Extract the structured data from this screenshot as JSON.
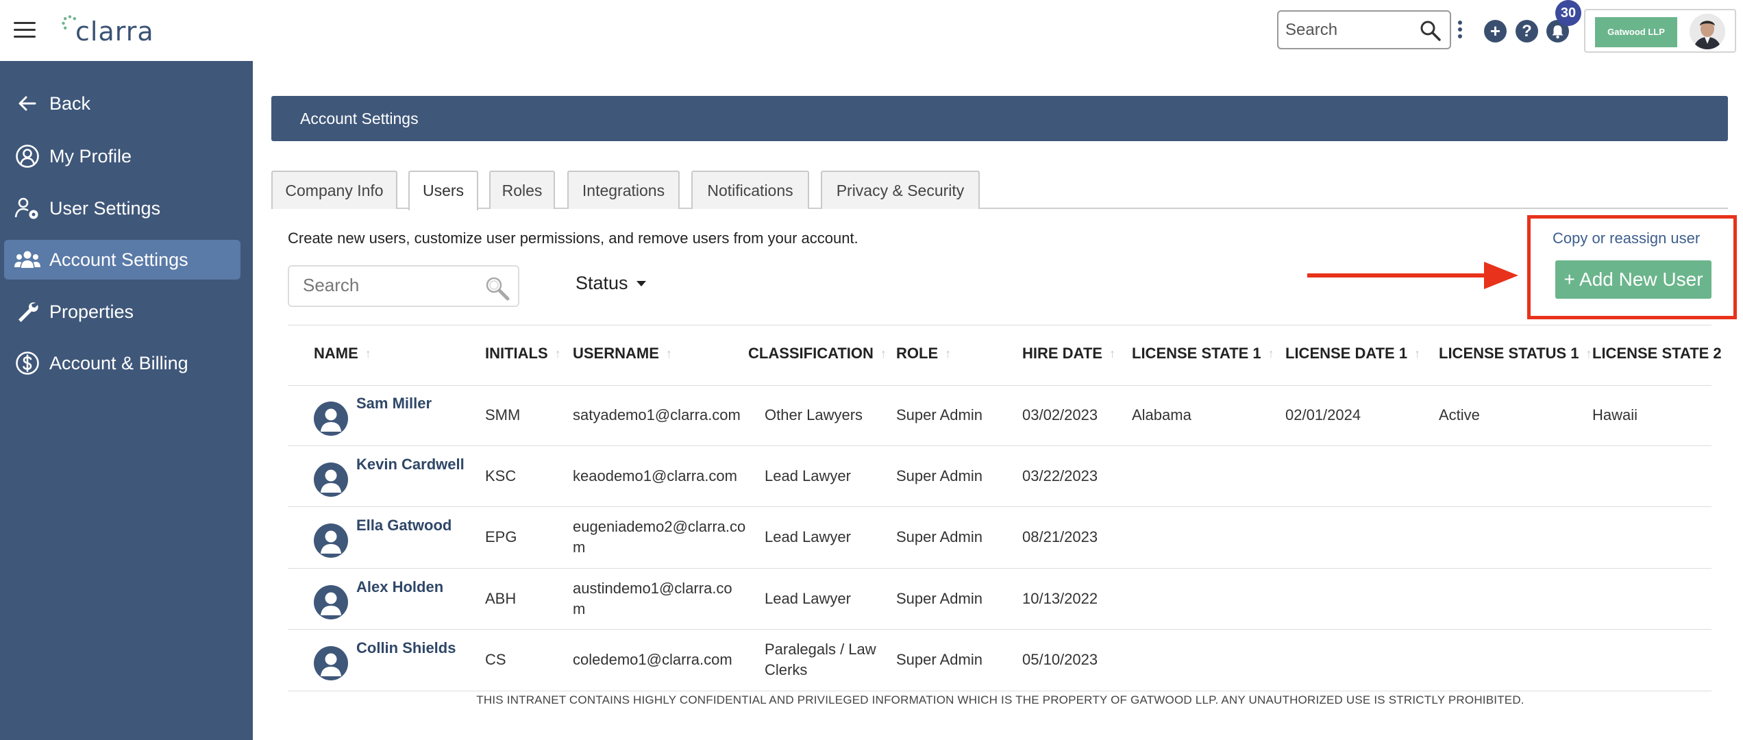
{
  "app": {
    "logo_text": "clarra"
  },
  "topbar": {
    "search_placeholder": "Search",
    "notification_count": "30",
    "firm_logo_text": "Gatwood LLP"
  },
  "sidebar": {
    "items": [
      {
        "label": "Back",
        "icon": "arrow-left-icon"
      },
      {
        "label": "My Profile",
        "icon": "user-circle-icon"
      },
      {
        "label": "User Settings",
        "icon": "user-gear-icon"
      },
      {
        "label": "Account Settings",
        "icon": "users-group-icon",
        "active": true
      },
      {
        "label": "Properties",
        "icon": "wrench-icon"
      },
      {
        "label": "Account & Billing",
        "icon": "dollar-circle-icon"
      }
    ]
  },
  "main": {
    "banner_title": "Account Settings",
    "tabs": [
      {
        "label": "Company Info"
      },
      {
        "label": "Users",
        "active": true
      },
      {
        "label": "Roles"
      },
      {
        "label": "Integrations"
      },
      {
        "label": "Notifications"
      },
      {
        "label": "Privacy & Security"
      }
    ],
    "description": "Create new users, customize user permissions, and remove users from your account.",
    "copy_reassign_link": "Copy or reassign user",
    "add_user_button": "+ Add New User",
    "search_placeholder": "Search",
    "status_filter": "Status",
    "colors": {
      "nav": "#3f5779",
      "accent_green": "#6bb58c",
      "highlight_red": "#e8321b"
    }
  },
  "table": {
    "columns": [
      "NAME",
      "INITIALS",
      "USERNAME",
      "CLASSIFICATION",
      "ROLE",
      "HIRE DATE",
      "LICENSE STATE 1",
      "LICENSE DATE 1",
      "LICENSE STATUS 1",
      "LICENSE STATE 2"
    ],
    "rows": [
      {
        "name": "Sam Miller",
        "initials": "SMM",
        "username": [
          "satyademo1@clarra.com"
        ],
        "classification": [
          "Other Lawyers"
        ],
        "role": "Super Admin",
        "hire_date": "03/02/2023",
        "license_state_1": "Alabama",
        "license_date_1": "02/01/2024",
        "license_status_1": "Active",
        "license_state_2": "Hawaii"
      },
      {
        "name": "Kevin Cardwell",
        "initials": "KSC",
        "username": [
          "keaodemo1@clarra.com"
        ],
        "classification": [
          "Lead Lawyer"
        ],
        "role": "Super Admin",
        "hire_date": "03/22/2023",
        "license_state_1": "",
        "license_date_1": "",
        "license_status_1": "",
        "license_state_2": ""
      },
      {
        "name": "Ella Gatwood",
        "initials": "EPG",
        "username": [
          "eugeniademo2@clarra.co",
          "m"
        ],
        "classification": [
          "Lead Lawyer"
        ],
        "role": "Super Admin",
        "hire_date": "08/21/2023",
        "license_state_1": "",
        "license_date_1": "",
        "license_status_1": "",
        "license_state_2": ""
      },
      {
        "name": "Alex Holden",
        "initials": "ABH",
        "username": [
          "austindemo1@clarra.co",
          "m"
        ],
        "classification": [
          "Lead Lawyer"
        ],
        "role": "Super Admin",
        "hire_date": "10/13/2022",
        "license_state_1": "",
        "license_date_1": "",
        "license_status_1": "",
        "license_state_2": ""
      },
      {
        "name": "Collin Shields",
        "initials": "CS",
        "username": [
          "coledemo1@clarra.com"
        ],
        "classification": [
          "Paralegals / Law",
          "Clerks"
        ],
        "role": "Super Admin",
        "hire_date": "05/10/2023",
        "license_state_1": "",
        "license_date_1": "",
        "license_status_1": "",
        "license_state_2": ""
      }
    ]
  },
  "footer": {
    "notice": "THIS INTRANET CONTAINS HIGHLY CONFIDENTIAL AND PRIVILEGED INFORMATION WHICH IS THE PROPERTY OF GATWOOD LLP. ANY UNAUTHORIZED USE IS STRICTLY PROHIBITED."
  }
}
